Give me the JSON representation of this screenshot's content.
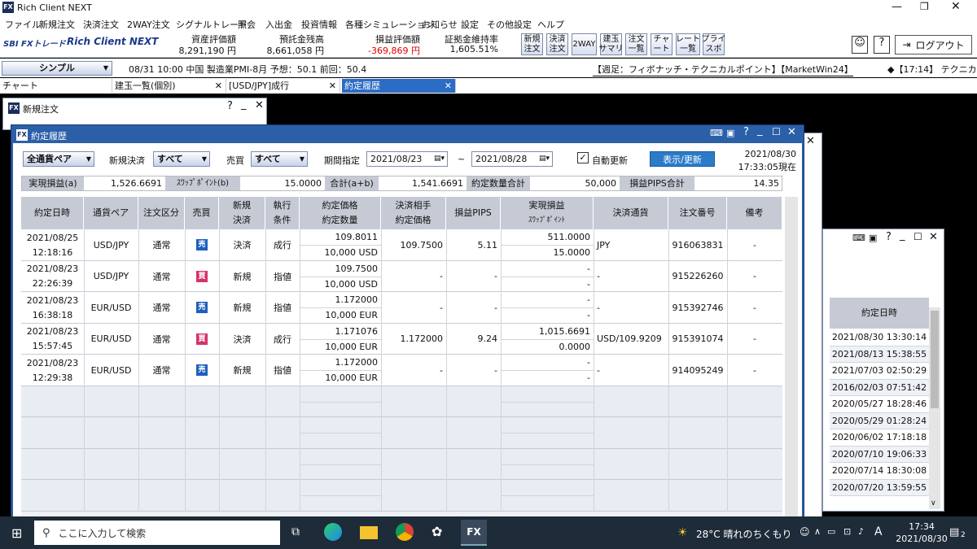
{
  "app": {
    "title": "Rich Client NEXT",
    "logo": "SBI FXトレード",
    "logo2": "Rich Client NEXT"
  },
  "menu": [
    "ファイル",
    "新規注文",
    "決済注文",
    "2WAY注文",
    "シグナルトレード",
    "照会",
    "入出金",
    "投資情報",
    "各種シミュレーション",
    "お知らせ",
    "設定",
    "その他設定",
    "ヘルプ"
  ],
  "summary": [
    {
      "label": "資産評価額",
      "value": "8,291,190 円"
    },
    {
      "label": "預託金残高",
      "value": "8,661,058 円"
    },
    {
      "label": "損益評価額",
      "value": "-369,869 円"
    },
    {
      "label": "証拠金維持率",
      "value": "1,605.51%"
    }
  ],
  "toolbar_buttons": [
    "新規\n注文",
    "決済\n注文",
    "2WAY",
    "建玉\nサマリ",
    "注文\n一覧",
    "チャ\nート",
    "レート\n一覧",
    "プライ\nスボ"
  ],
  "logout": "ログアウト",
  "mode": "シンプル",
  "news": "08/31 10:00 中国 製造業PMI-8月 予想：50.1 前回：50.4",
  "ticker1": "【週足：フィボナッチ・テクニカルポイント】【MarketWin24】",
  "ticker2": "◆【17:14】 テクニカ",
  "tabs": [
    "チャート",
    "建玉一覧(個別)",
    "[USD/JPY]成行",
    "約定履歴"
  ],
  "neworder_title": "新規注文",
  "main": {
    "title": "約定履歴",
    "pair": "全通貨ペア",
    "kind_label": "新規決済",
    "kind": "すべて",
    "side_label": "売買",
    "side": "すべて",
    "period_label": "期間指定",
    "date_from": "2021/08/23",
    "tilde": "~",
    "date_to": "2021/08/28",
    "auto_label": "自動更新",
    "refresh": "表示/更新",
    "asof_date": "2021/08/30",
    "asof_time": "17:33:05現在",
    "totals": [
      {
        "label": "実現損益(a)",
        "value": "1,526.6691"
      },
      {
        "label": "ｽﾜｯﾌﾟﾎﾟｲﾝﾄ(b)",
        "value": "15.0000"
      },
      {
        "label": "合計(a+b)",
        "value": "1,541.6691"
      },
      {
        "label": "約定数量合計",
        "value": "50,000"
      },
      {
        "label": "損益PIPS合計",
        "value": "14.35"
      }
    ],
    "headers": [
      [
        "約定日時"
      ],
      [
        "通貨ペア"
      ],
      [
        "注文区分"
      ],
      [
        "売買"
      ],
      [
        "新規",
        "決済"
      ],
      [
        "執行",
        "条件"
      ],
      [
        "約定価格",
        "約定数量"
      ],
      [
        "決済相手",
        "約定価格"
      ],
      [
        "損益PIPS"
      ],
      [
        "実現損益",
        "ｽﾜｯﾌﾟﾎﾟｲﾝﾄ"
      ],
      [
        "決済通貨"
      ],
      [
        "注文番号"
      ],
      [
        "備考"
      ]
    ],
    "rows": [
      {
        "d1": "2021/08/25",
        "d2": "12:18:16",
        "pair": "USD/JPY",
        "type": "通常",
        "side": "売",
        "nk": "決済",
        "cond": "成行",
        "price": "109.8011",
        "qty": "10,000 USD",
        "cp": "109.7500",
        "pips": "5.11",
        "pl": "511.0000",
        "swap": "15.0000",
        "ccy": "JPY",
        "no": "916063831",
        "memo": "-"
      },
      {
        "d1": "2021/08/23",
        "d2": "22:26:39",
        "pair": "USD/JPY",
        "type": "通常",
        "side": "買",
        "nk": "新規",
        "cond": "指値",
        "price": "109.7500",
        "qty": "10,000 USD",
        "cp": "-",
        "pips": "-",
        "pl": "-",
        "swap": "-",
        "ccy": "-",
        "no": "915226260",
        "memo": "-"
      },
      {
        "d1": "2021/08/23",
        "d2": "16:38:18",
        "pair": "EUR/USD",
        "type": "通常",
        "side": "売",
        "nk": "新規",
        "cond": "指値",
        "price": "1.172000",
        "qty": "10,000 EUR",
        "cp": "-",
        "pips": "-",
        "pl": "-",
        "swap": "-",
        "ccy": "-",
        "no": "915392746",
        "memo": "-"
      },
      {
        "d1": "2021/08/23",
        "d2": "15:57:45",
        "pair": "EUR/USD",
        "type": "通常",
        "side": "買",
        "nk": "決済",
        "cond": "成行",
        "price": "1.171076",
        "qty": "10,000 EUR",
        "cp": "1.172000",
        "pips": "9.24",
        "pl": "1,015.6691",
        "swap": "0.0000",
        "ccy": "USD/109.9209",
        "no": "915391074",
        "memo": "-"
      },
      {
        "d1": "2021/08/23",
        "d2": "12:29:38",
        "pair": "EUR/USD",
        "type": "通常",
        "side": "売",
        "nk": "新規",
        "cond": "指値",
        "price": "1.172000",
        "qty": "10,000 EUR",
        "cp": "-",
        "pips": "-",
        "pl": "-",
        "swap": "-",
        "ccy": "-",
        "no": "914095249",
        "memo": "-"
      }
    ]
  },
  "side_window": {
    "header": "約定日時",
    "dates": [
      "2021/08/30 13:30:14",
      "2021/08/13 15:38:55",
      "2021/07/03 02:50:29",
      "2016/02/03 07:51:42",
      "2020/05/27 18:28:46",
      "2020/05/29 01:28:24",
      "2020/06/02 17:18:18",
      "2020/07/10 19:06:33",
      "2020/07/14 18:30:08",
      "2020/07/20 13:59:55"
    ]
  },
  "taskbar": {
    "search": "ここに入力して検索",
    "weather": "28°C 晴れのちくもり",
    "ime": "A",
    "time": "17:34",
    "date": "2021/08/30",
    "notif": "2"
  },
  "colors": {
    "sell": "#1f5fbf",
    "buy": "#d6336c",
    "title_bar": "#2b5fa8",
    "loss": "#e00000"
  }
}
